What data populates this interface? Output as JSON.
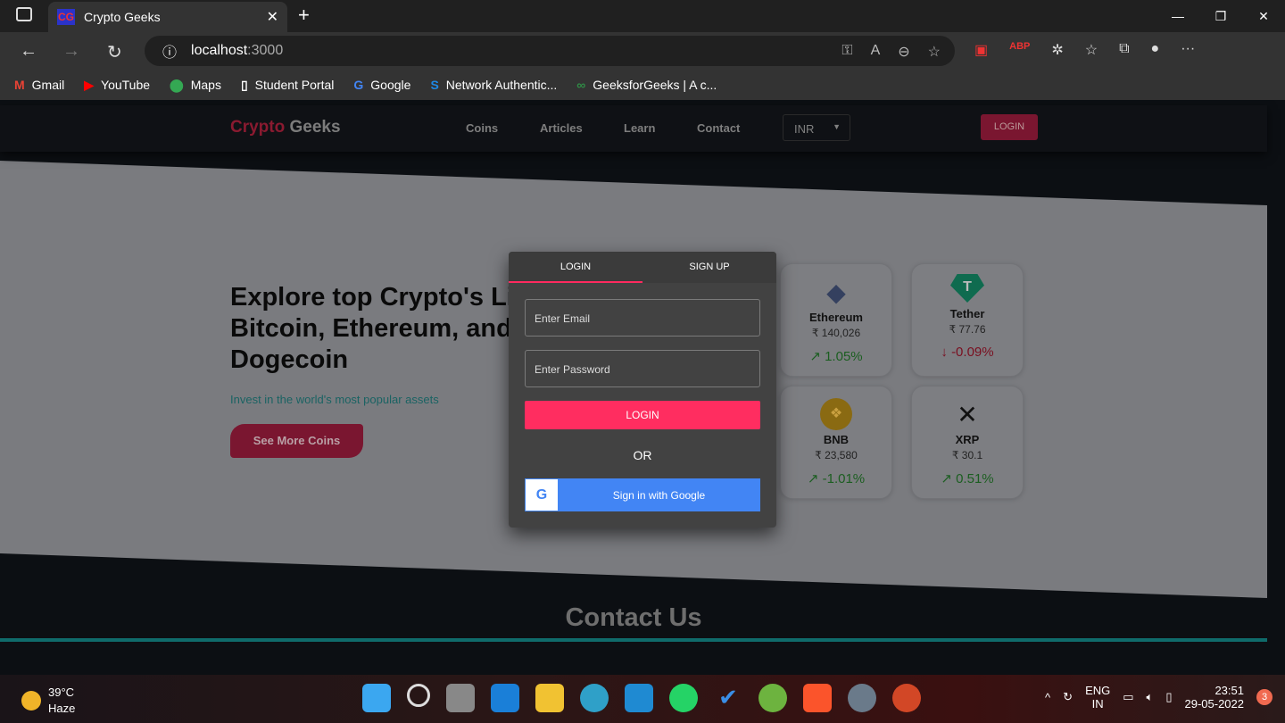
{
  "browser": {
    "tab_title": "Crypto Geeks",
    "favicon_text": "CG",
    "url_host": "localhost",
    "url_port": ":3000",
    "bookmarks": [
      "Gmail",
      "YouTube",
      "Maps",
      "Student Portal",
      "Google",
      "Network Authentic...",
      "GeeksforGeeks | A c..."
    ]
  },
  "header": {
    "logo_a": "Crypto",
    "logo_b": "Geeks",
    "nav": [
      "Coins",
      "Articles",
      "Learn",
      "Contact"
    ],
    "currency": "INR",
    "login": "LOGIN"
  },
  "hero": {
    "title": "Explore top Crypto's Like Bitcoin, Ethereum, and Dogecoin",
    "subtitle": "Invest in the world's most popular assets",
    "cta": "See More Coins"
  },
  "coins": [
    {
      "name": "Ethereum",
      "price": "₹ 140,026",
      "change": "1.05%",
      "dir": "up",
      "color": "#627eea"
    },
    {
      "name": "Tether",
      "price": "₹ 77.76",
      "change": "-0.09%",
      "dir": "down",
      "color": "#26a17b"
    },
    {
      "name": "BNB",
      "price": "₹ 23,580",
      "change": "-1.01%",
      "dir": "up",
      "color": "#f3ba2f"
    },
    {
      "name": "XRP",
      "price": "₹ 30.1",
      "change": "0.51%",
      "dir": "up",
      "color": "#222222"
    }
  ],
  "modal": {
    "tab_login": "LOGIN",
    "tab_signup": "SIGN UP",
    "email_placeholder": "Enter Email",
    "password_placeholder": "Enter Password",
    "login": "LOGIN",
    "or": "OR",
    "google": "Sign in with Google"
  },
  "contact_title": "Contact Us",
  "taskbar": {
    "temp": "39°C",
    "weather": "Haze",
    "lang1": "ENG",
    "lang2": "IN",
    "time": "23:51",
    "date": "29-05-2022",
    "notifications": "3"
  }
}
